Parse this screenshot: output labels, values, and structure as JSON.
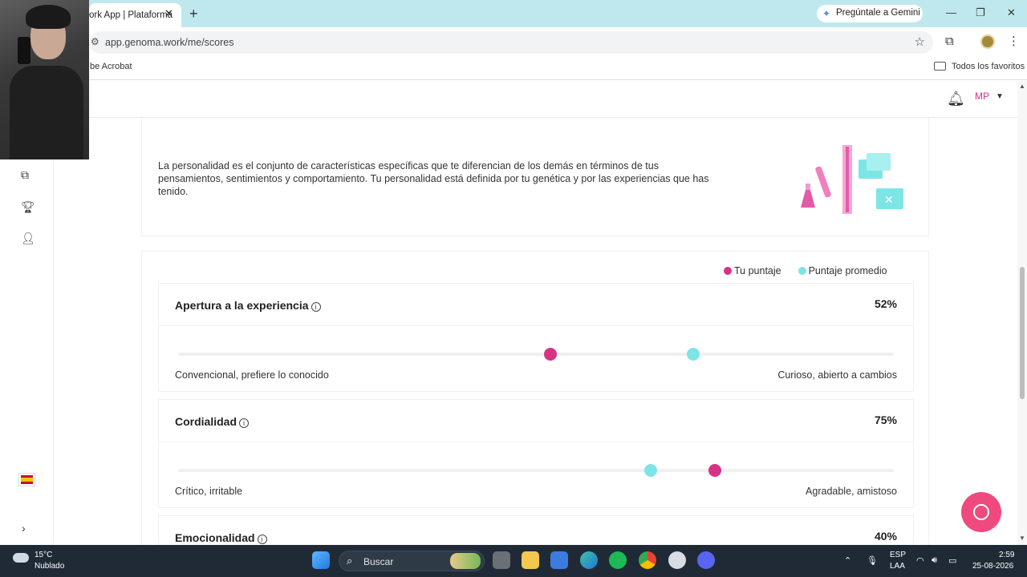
{
  "browser": {
    "tab_title": "ork App | Plataforma",
    "tab_close": "✕",
    "new_tab": "+",
    "gemini_label": "Pregúntale a Gemini",
    "url": "app.genoma.work/me/scores",
    "bookmark_left": "be Acrobat",
    "bookmark_right": "Todos los favoritos"
  },
  "header": {
    "avatar_initials": "MP"
  },
  "intro": {
    "description": "La personalidad es el conjunto de características específicas que te diferencian de los demás en términos de tus pensamientos, sentimientos y comportamiento. Tu personalidad está definida por tu genética y por las experiencias que has tenido."
  },
  "legend": {
    "user_label": "Tu puntaje",
    "avg_label": "Puntaje promedio",
    "user_color": "#d63384",
    "avg_color": "#7de5e6"
  },
  "traits": [
    {
      "name": "Apertura a la experiencia",
      "percent": "52%",
      "user_value": 0.52,
      "avg_value": 0.72,
      "left_label": "Convencional, prefiere lo conocido",
      "right_label": "Curioso, abierto a cambios"
    },
    {
      "name": "Cordialidad",
      "percent": "75%",
      "user_value": 0.75,
      "avg_value": 0.66,
      "left_label": "Crítico, irritable",
      "right_label": "Agradable, amistoso"
    },
    {
      "name": "Emocionalidad",
      "percent": "40%"
    }
  ],
  "taskbar": {
    "temperature": "15°C",
    "weather": "Nublado",
    "search_placeholder": "Buscar",
    "lang_line1": "ESP",
    "lang_line2": "LAA",
    "time": "2:59",
    "date": "25-08-2026"
  }
}
